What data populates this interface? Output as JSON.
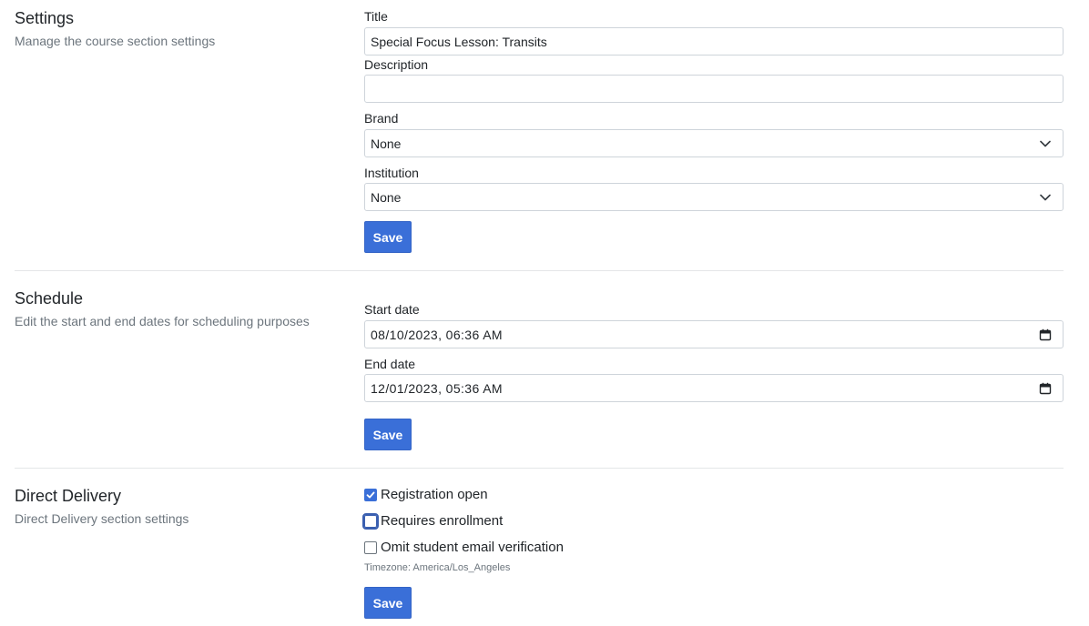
{
  "settings": {
    "title": "Settings",
    "subtitle": "Manage the course section settings",
    "title_label": "Title",
    "title_value": "Special Focus Lesson: Transits",
    "description_label": "Description",
    "description_value": "",
    "brand_label": "Brand",
    "brand_value": "None",
    "institution_label": "Institution",
    "institution_value": "None",
    "save_label": "Save"
  },
  "schedule": {
    "title": "Schedule",
    "subtitle": "Edit the start and end dates for scheduling purposes",
    "start_label": "Start date",
    "start_value": "08/10/2023, 06:36 AM",
    "end_label": "End date",
    "end_value": "12/01/2023, 05:36 AM",
    "save_label": "Save"
  },
  "direct_delivery": {
    "title": "Direct Delivery",
    "subtitle": "Direct Delivery section settings",
    "checkboxes": [
      {
        "label": "Registration open",
        "checked": true
      },
      {
        "label": "Requires enrollment",
        "checked": false
      },
      {
        "label": "Omit student email verification",
        "checked": false
      }
    ],
    "timezone_text": "Timezone: America/Los_Angeles",
    "save_label": "Save"
  },
  "colors": {
    "primary": "#3a6fd8",
    "muted_text": "#6c757d",
    "border": "#ced4da"
  },
  "icons": {
    "select": "chevron-down-icon",
    "date": "calendar-icon",
    "check": "checkmark-icon"
  }
}
